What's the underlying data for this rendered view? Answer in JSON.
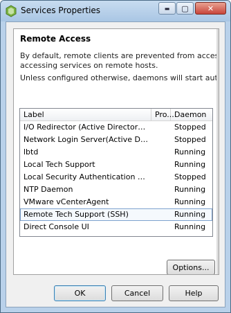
{
  "window": {
    "title": "Services Properties",
    "minimize_glyph": "▬",
    "maximize_glyph": "▢",
    "close_glyph": "✕",
    "app_icon": "vsphere-logo-icon"
  },
  "section": {
    "title": "Remote Access",
    "description_line1": "By default, remote clients are prevented from accessing serv",
    "description_line2": "accessing services on remote hosts.",
    "description_line3": "Unless configured otherwise, daemons will start automatically"
  },
  "list": {
    "headers": {
      "label": "Label",
      "protocol": "Pro...",
      "daemon": "Daemon"
    },
    "rows": [
      {
        "label": "I/O Redirector (Active Directory Se...",
        "daemon": "Stopped"
      },
      {
        "label": "Network Login Server(Active Direc...",
        "daemon": "Stopped"
      },
      {
        "label": "lbtd",
        "daemon": "Running"
      },
      {
        "label": "Local Tech Support",
        "daemon": "Running"
      },
      {
        "label": "Local Security Authentication Serv...",
        "daemon": "Stopped"
      },
      {
        "label": "NTP Daemon",
        "daemon": "Running"
      },
      {
        "label": "VMware vCenterAgent",
        "daemon": "Running"
      },
      {
        "label": "Remote Tech Support (SSH)",
        "daemon": "Running",
        "selected": true
      },
      {
        "label": "Direct Console UI",
        "daemon": "Running"
      }
    ]
  },
  "buttons": {
    "options": "Options...",
    "ok": "OK",
    "cancel": "Cancel",
    "help": "Help"
  },
  "colors": {
    "frame": "#b9d1ea",
    "selection_border": "#7da2ce"
  }
}
